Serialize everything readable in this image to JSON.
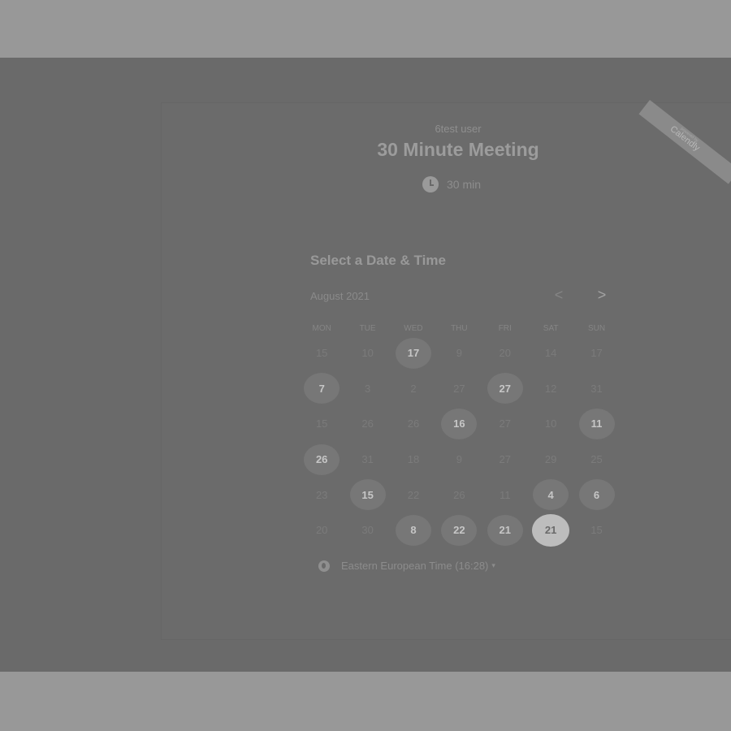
{
  "host_name": "6test user",
  "event_title": "30 Minute Meeting",
  "duration_label": "30 min",
  "section_title": "Select a Date & Time",
  "month_label": "August 2021",
  "nav": {
    "prev": "<",
    "next": ">"
  },
  "ribbon": {
    "small": "powered by",
    "label": "Calendly"
  },
  "weekdays": [
    "MON",
    "TUE",
    "WED",
    "THU",
    "FRI",
    "SAT",
    "SUN"
  ],
  "weeks": [
    [
      {
        "d": "15",
        "s": ""
      },
      {
        "d": "10",
        "s": ""
      },
      {
        "d": "17",
        "s": "available"
      },
      {
        "d": "9",
        "s": ""
      },
      {
        "d": "20",
        "s": ""
      },
      {
        "d": "14",
        "s": ""
      },
      {
        "d": "17",
        "s": ""
      }
    ],
    [
      {
        "d": "7",
        "s": "available"
      },
      {
        "d": "3",
        "s": ""
      },
      {
        "d": "2",
        "s": ""
      },
      {
        "d": "27",
        "s": ""
      },
      {
        "d": "27",
        "s": "available"
      },
      {
        "d": "12",
        "s": ""
      },
      {
        "d": "31",
        "s": ""
      }
    ],
    [
      {
        "d": "15",
        "s": ""
      },
      {
        "d": "26",
        "s": ""
      },
      {
        "d": "26",
        "s": ""
      },
      {
        "d": "16",
        "s": "available"
      },
      {
        "d": "27",
        "s": ""
      },
      {
        "d": "10",
        "s": ""
      },
      {
        "d": "11",
        "s": "available"
      }
    ],
    [
      {
        "d": "26",
        "s": "available"
      },
      {
        "d": "31",
        "s": ""
      },
      {
        "d": "18",
        "s": ""
      },
      {
        "d": "9",
        "s": ""
      },
      {
        "d": "27",
        "s": ""
      },
      {
        "d": "29",
        "s": ""
      },
      {
        "d": "25",
        "s": ""
      }
    ],
    [
      {
        "d": "23",
        "s": ""
      },
      {
        "d": "15",
        "s": "available"
      },
      {
        "d": "22",
        "s": ""
      },
      {
        "d": "26",
        "s": ""
      },
      {
        "d": "11",
        "s": ""
      },
      {
        "d": "4",
        "s": "available"
      },
      {
        "d": "6",
        "s": "available"
      }
    ],
    [
      {
        "d": "20",
        "s": ""
      },
      {
        "d": "30",
        "s": ""
      },
      {
        "d": "8",
        "s": "available"
      },
      {
        "d": "22",
        "s": "available"
      },
      {
        "d": "21",
        "s": "available"
      },
      {
        "d": "21",
        "s": "selected"
      },
      {
        "d": "15",
        "s": ""
      }
    ]
  ],
  "timezone_label": "Eastern European Time (16:28)",
  "timezone_caret": "▾"
}
